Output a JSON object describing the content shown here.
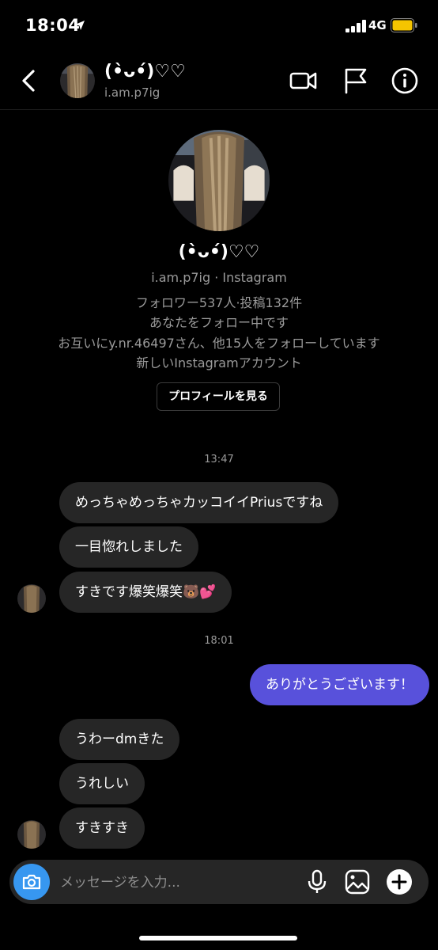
{
  "status_bar": {
    "time": "18:04",
    "network": "4G"
  },
  "header": {
    "display_name": "(•̀ᴗ•́)♡♡",
    "username": "i.am.p7ig"
  },
  "profile": {
    "display_name": "(•̀ᴗ•́)♡♡",
    "subtitle": "i.am.p7ig · Instagram",
    "stats": "フォロワー537人·投稿132件",
    "follows_you": "あなたをフォロー中です",
    "mutuals": "お互いにy.nr.46497さん、他15人をフォローしています",
    "new_account": "新しいInstagramアカウント",
    "view_profile_label": "プロフィールを見る"
  },
  "chat": {
    "timestamps": [
      "13:47",
      "18:01"
    ],
    "messages": [
      {
        "from": "them",
        "text": "めっちゃめっちゃカッコイイPriusですね"
      },
      {
        "from": "them",
        "text": "一目惚れしました"
      },
      {
        "from": "them",
        "text": "すきです爆笑爆笑🐻💕"
      },
      {
        "from": "me",
        "text": "ありがとうございます！"
      },
      {
        "from": "them",
        "text": "うわーdmきた"
      },
      {
        "from": "them",
        "text": "うれしい"
      },
      {
        "from": "them",
        "text": "すきすき"
      }
    ]
  },
  "composer": {
    "placeholder": "メッセージを入力..."
  },
  "icons": [
    "location-arrow-icon",
    "signal-bars-icon",
    "battery-icon",
    "back-chevron-icon",
    "video-call-icon",
    "flag-icon",
    "info-icon",
    "camera-icon",
    "microphone-icon",
    "gallery-icon",
    "plus-icon"
  ],
  "colors": {
    "accent_bubble": "#5851db",
    "camera_button": "#3797f0",
    "battery": "#f5c400",
    "other_bubble": "#262626"
  }
}
